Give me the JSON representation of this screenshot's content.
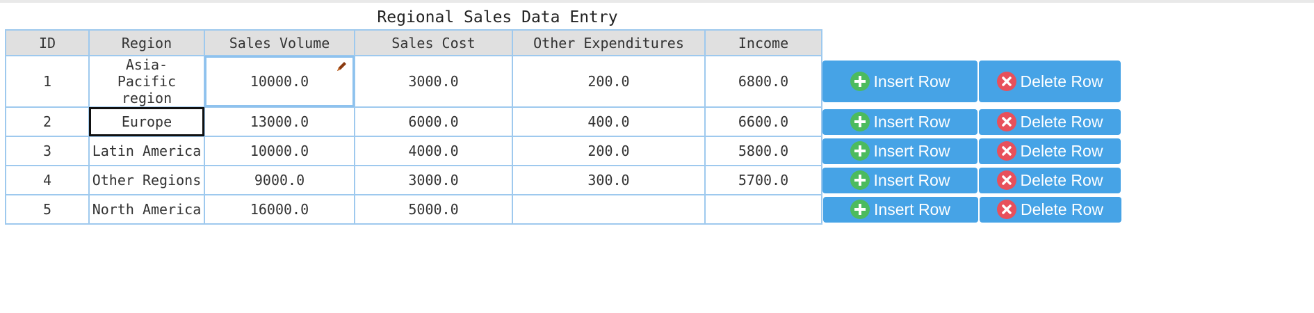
{
  "title": "Regional Sales Data Entry",
  "columns": [
    "ID",
    "Region",
    "Sales Volume",
    "Sales Cost",
    "Other Expenditures",
    "Income"
  ],
  "rows": [
    {
      "id": "1",
      "region": "Asia-Pacific region",
      "sales_volume": "10000.0",
      "sales_cost": "3000.0",
      "other_expenditures": "200.0",
      "income": "6800.0"
    },
    {
      "id": "2",
      "region": "Europe",
      "sales_volume": "13000.0",
      "sales_cost": "6000.0",
      "other_expenditures": "400.0",
      "income": "6600.0"
    },
    {
      "id": "3",
      "region": "Latin America",
      "sales_volume": "10000.0",
      "sales_cost": "4000.0",
      "other_expenditures": "200.0",
      "income": "5800.0"
    },
    {
      "id": "4",
      "region": "Other Regions",
      "sales_volume": "9000.0",
      "sales_cost": "3000.0",
      "other_expenditures": "300.0",
      "income": "5700.0"
    },
    {
      "id": "5",
      "region": "North America",
      "sales_volume": "16000.0",
      "sales_cost": "5000.0",
      "other_expenditures": "",
      "income": ""
    }
  ],
  "actions": {
    "insert_label": "Insert Row",
    "delete_label": "Delete Row"
  },
  "colors": {
    "button_bg": "#46a3e6",
    "insert_icon": "#4cbb5e",
    "delete_icon": "#e8505b",
    "cell_border": "#9ec9ee",
    "header_bg": "#e0e0e0"
  },
  "icons": {
    "insert": "plus-circle-icon",
    "delete": "x-circle-icon",
    "edit": "pencil-icon"
  }
}
